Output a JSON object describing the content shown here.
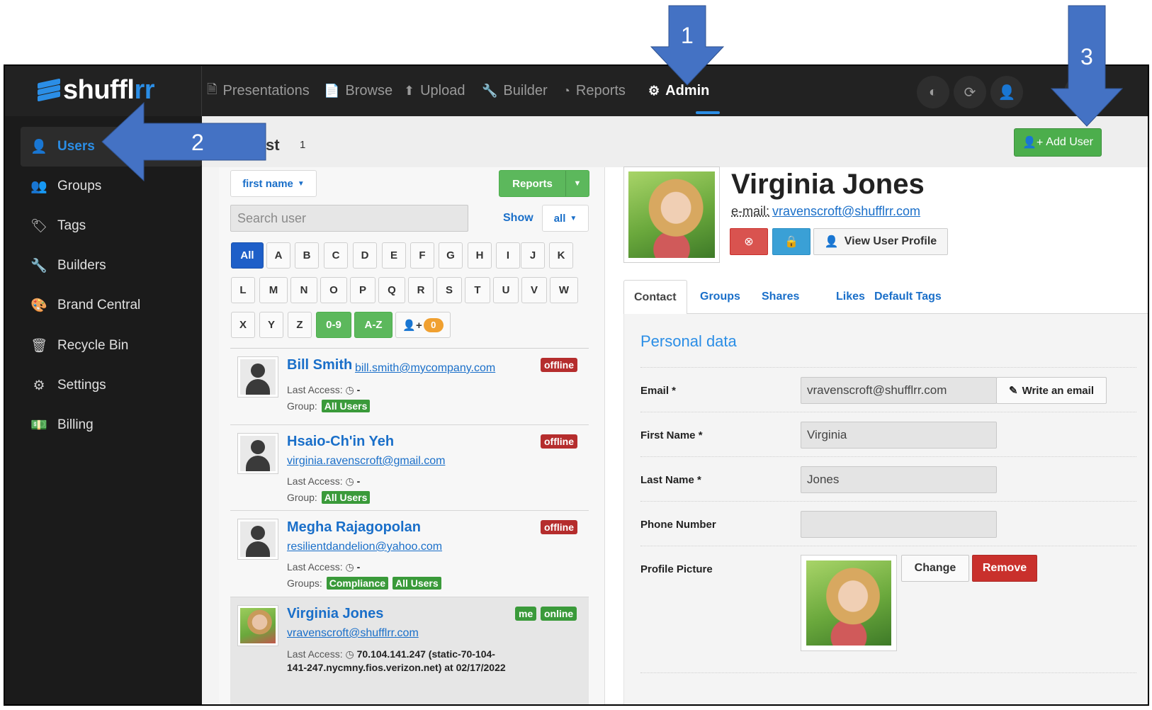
{
  "app": {
    "logo_main": "shuffl",
    "logo_accent": "rr"
  },
  "topnav": {
    "items": [
      {
        "label": "Presentations",
        "icon": "file-p-icon"
      },
      {
        "label": "Browse",
        "icon": "document-icon"
      },
      {
        "label": "Upload",
        "icon": "upload-icon"
      },
      {
        "label": "Builder",
        "icon": "wrench-icon"
      },
      {
        "label": "Reports",
        "icon": "pie-chart-icon"
      },
      {
        "label": "Admin",
        "icon": "gear-icon",
        "active": true
      }
    ]
  },
  "sidebar": {
    "items": [
      {
        "label": "Users",
        "icon": "user-icon",
        "active": true
      },
      {
        "label": "Groups",
        "icon": "users-icon"
      },
      {
        "label": "Tags",
        "icon": "tags-icon"
      },
      {
        "label": "Builders",
        "icon": "wrench-icon"
      },
      {
        "label": "Brand Central",
        "icon": "palette-icon"
      },
      {
        "label": "Recycle Bin",
        "icon": "trash-icon"
      },
      {
        "label": "Settings",
        "icon": "gears-icon"
      },
      {
        "label": "Billing",
        "icon": "money-icon"
      }
    ]
  },
  "header": {
    "title_partial": "st",
    "count": "1",
    "add_user_label": "Add User"
  },
  "list": {
    "sort_label": "first name",
    "reports_label": "Reports",
    "search_placeholder": "Search user",
    "show_label": "Show",
    "show_value": "all",
    "letters_row1": [
      "All",
      "A",
      "B",
      "C",
      "D",
      "E",
      "F",
      "G",
      "H",
      "I",
      "J",
      "K"
    ],
    "letters_row2": [
      "L",
      "M",
      "N",
      "O",
      "P",
      "Q",
      "R",
      "S",
      "T",
      "U",
      "V",
      "W"
    ],
    "letters_row3": [
      "X",
      "Y",
      "Z",
      "0-9",
      "A-Z"
    ],
    "pending_count": "0",
    "last_access_label": "Last Access:",
    "users": [
      {
        "name": "Bill Smith",
        "email": "bill.smith@mycompany.com",
        "status": "offline",
        "last_access": "-",
        "group_label": "Group:",
        "groups": [
          "All Users"
        ]
      },
      {
        "name": "Hsaio-Ch'in Yeh",
        "email": "virginia.ravenscroft@gmail.com",
        "status": "offline",
        "last_access": "-",
        "group_label": "Group:",
        "groups": [
          "All Users"
        ]
      },
      {
        "name": "Megha Rajagopolan",
        "email": "resilientdandelion@yahoo.com",
        "status": "offline",
        "last_access": "-",
        "group_label": "Groups:",
        "groups": [
          "Compliance",
          "All Users"
        ]
      },
      {
        "name": "Virginia Jones",
        "email": "vravenscroft@shufflrr.com",
        "me": "me",
        "status": "online",
        "last_access_line1": "70.104.141.247 (static-70-104-",
        "last_access_line2": "141-247.nycmny.fios.verizon.net) at 02/17/2022"
      }
    ]
  },
  "detail": {
    "name": "Virginia Jones",
    "email_label": "e-mail:",
    "email": "vravenscroft@shufflrr.com",
    "view_profile_label": "View User Profile",
    "tabs": [
      "Contact",
      "Groups",
      "Shares",
      "Likes",
      "Default Tags"
    ],
    "section_title": "Personal data",
    "fields": {
      "email_label": "Email *",
      "email_value": "vravenscroft@shufflrr.com",
      "write_email_label": "Write an email",
      "first_name_label": "First Name *",
      "first_name_value": "Virginia",
      "last_name_label": "Last Name *",
      "last_name_value": "Jones",
      "phone_label": "Phone Number",
      "phone_value": "",
      "picture_label": "Profile Picture",
      "change_label": "Change",
      "remove_label": "Remove"
    }
  },
  "annotations": [
    "1",
    "2",
    "3"
  ],
  "colors": {
    "accent": "#2b8ee6",
    "nav_bg": "#222222",
    "sidebar_bg": "#1b1b1b",
    "success": "#5cb85c",
    "danger": "#c9302c",
    "callout": "#4472c4"
  }
}
